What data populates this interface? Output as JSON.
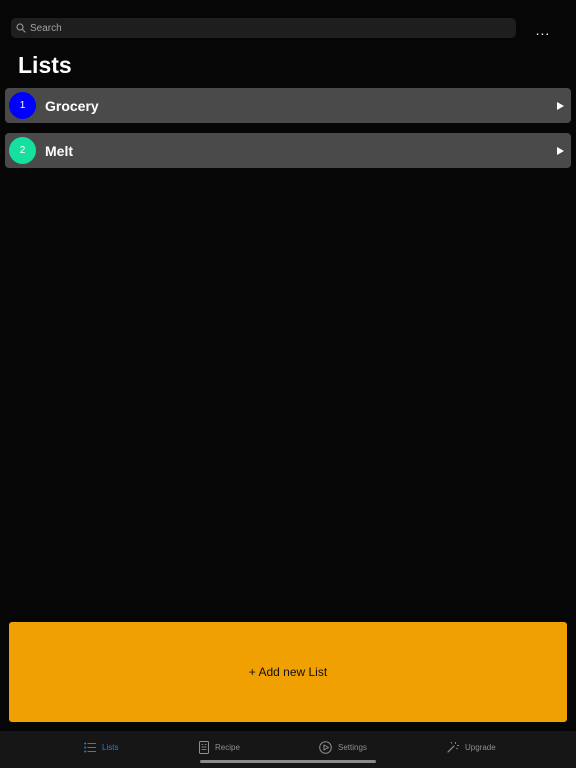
{
  "search": {
    "placeholder": "Search"
  },
  "header": {
    "more_label": "..."
  },
  "page": {
    "title": "Lists"
  },
  "lists": [
    {
      "number": "1",
      "name": "Grocery",
      "color": "#0000ff"
    },
    {
      "number": "2",
      "name": "Melt",
      "color": "#16e0a0"
    }
  ],
  "add_button": {
    "label": "+ Add new List",
    "color": "#f0a000"
  },
  "tabs": [
    {
      "label": "Lists",
      "icon": "list-icon",
      "active": true
    },
    {
      "label": "Recipe",
      "icon": "recipe-icon",
      "active": false
    },
    {
      "label": "Settings",
      "icon": "settings-icon",
      "active": false
    },
    {
      "label": "Upgrade",
      "icon": "magic-wand-icon",
      "active": false
    }
  ],
  "colors": {
    "accent": "#0a84ff",
    "background": "#060606",
    "row_background": "#4a4a4a"
  }
}
